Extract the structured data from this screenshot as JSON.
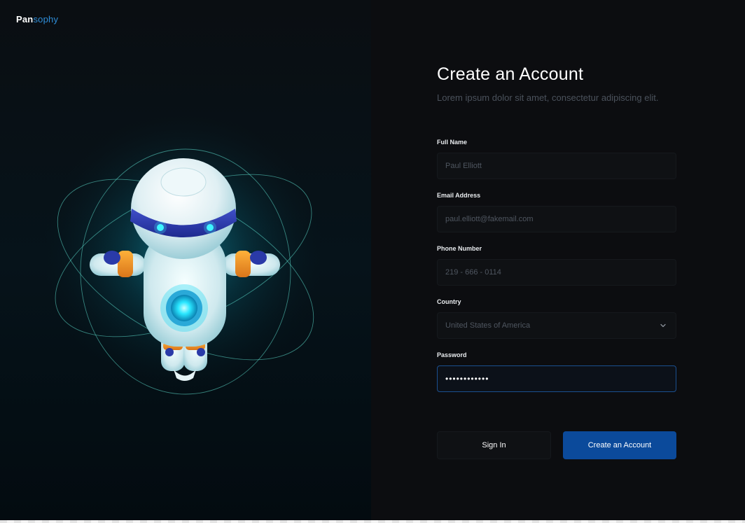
{
  "brand": {
    "name_part1": "Pan",
    "name_part2": "sophy",
    "accent_color": "#2f8dd8"
  },
  "illustration": {
    "icon": "robot-astronaut-illustration"
  },
  "form": {
    "title": "Create an Account",
    "subtitle": "Lorem ipsum dolor sit amet, consectetur adipiscing elit.",
    "full_name": {
      "label": "Full Name",
      "placeholder": "Paul Elliott"
    },
    "email": {
      "label": "Email Address",
      "placeholder": "paul.elliott@fakemail.com"
    },
    "phone": {
      "label": "Phone Number",
      "placeholder": "219 - 666 - 0114"
    },
    "country": {
      "label": "Country",
      "value": "United States of America",
      "icon": "chevron-down-icon"
    },
    "password": {
      "label": "Password",
      "value": "••••••••••••"
    },
    "sign_in_label": "Sign In",
    "create_label": "Create an Account",
    "primary_color": "#0b4a9b"
  }
}
